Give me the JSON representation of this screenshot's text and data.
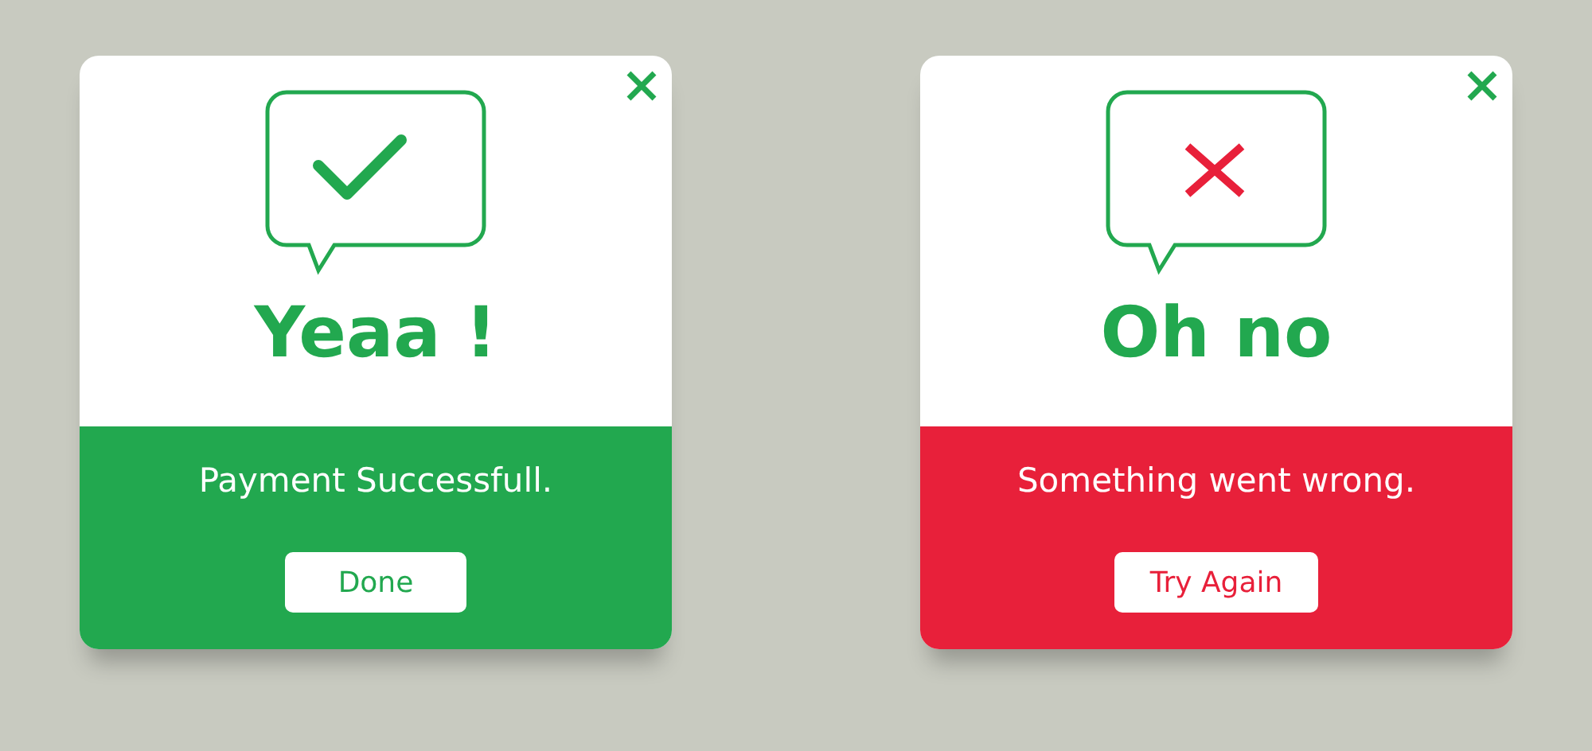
{
  "dialogs": [
    {
      "kind": "success",
      "title": "Yeaa !",
      "message": "Payment Successfull.",
      "button": "Done",
      "color": "#22a84f"
    },
    {
      "kind": "error",
      "title": "Oh no",
      "message": "Something went wrong.",
      "button": "Try Again",
      "color": "#e8203a"
    }
  ]
}
